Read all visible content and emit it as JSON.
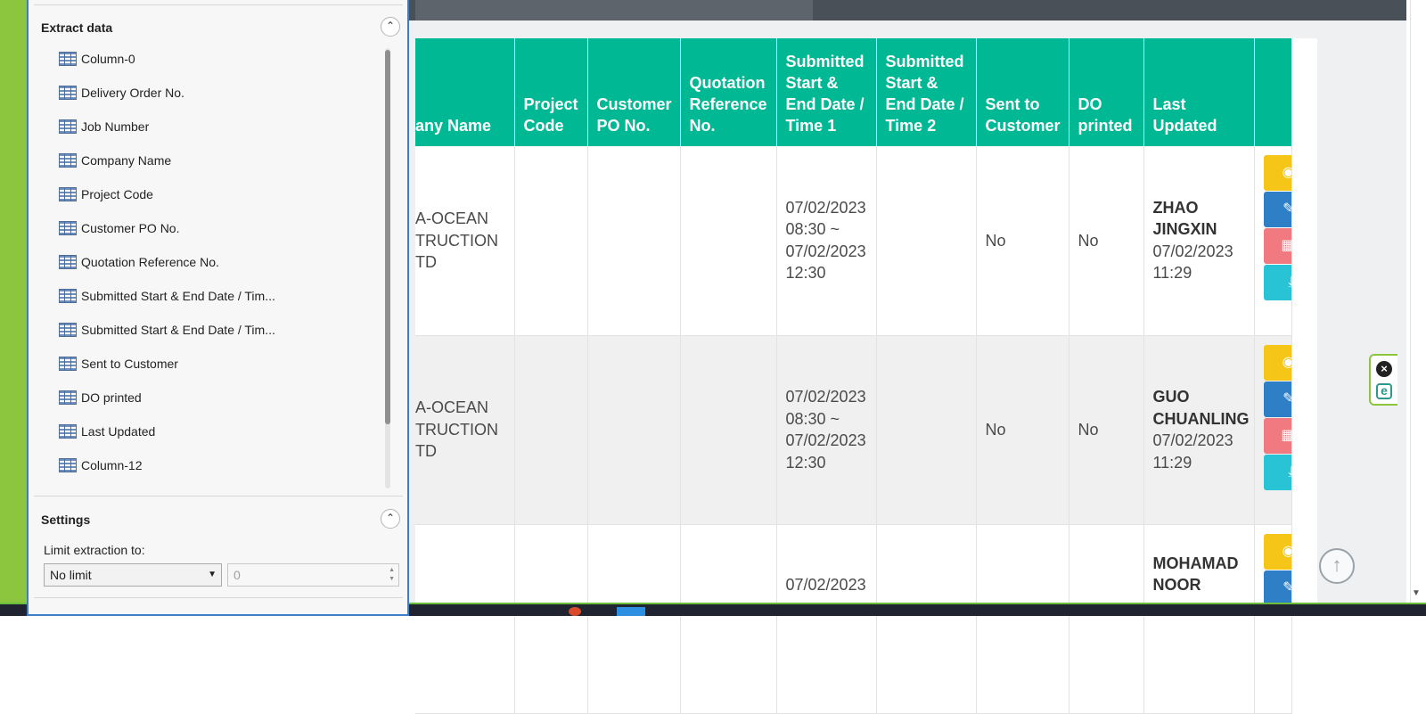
{
  "panel": {
    "extract_title": "Extract data",
    "columns": [
      "Column-0",
      "Delivery Order No.",
      "Job Number",
      "Company Name",
      "Project Code",
      "Customer PO No.",
      "Quotation Reference No.",
      "Submitted Start & End Date / Tim...",
      "Submitted Start & End Date / Tim...",
      "Sent to Customer",
      "DO printed",
      "Last Updated",
      "Column-12"
    ],
    "settings_title": "Settings",
    "limit_label": "Limit extraction to:",
    "limit_select_value": "No limit",
    "limit_number_value": "0"
  },
  "table": {
    "headers": {
      "company_name": "any Name",
      "project_code": "Project Code",
      "customer_po": "Customer PO No.",
      "quotation_ref": "Quotation Reference No.",
      "submitted_1": "Submitted Start & End Date / Time 1",
      "submitted_2": "Submitted Start & End Date / Time 2",
      "sent_to_customer": "Sent to Customer",
      "do_printed": "DO printed",
      "last_updated": "Last Updated"
    },
    "rows": [
      {
        "company": "A-OCEAN\nTRUCTION\nTD",
        "submitted_1": "07/02/2023 08:30 ~ 07/02/2023 12:30",
        "sent": "No",
        "printed": "No",
        "updated_by": "ZHAO JINGXIN",
        "updated_at": "07/02/2023 11:29"
      },
      {
        "company": "A-OCEAN\nTRUCTION\nTD",
        "submitted_1": "07/02/2023 08:30 ~ 07/02/2023 12:30",
        "sent": "No",
        "printed": "No",
        "updated_by": "GUO CHUANLING",
        "updated_at": "07/02/2023 11:29"
      },
      {
        "submitted_1": "07/02/2023",
        "updated_by": "MOHAMAD NOOR"
      }
    ]
  },
  "icons": {
    "collapse": "chevron-up-icon",
    "view": "eye-icon",
    "edit": "pencil-icon",
    "delete": "trash-icon",
    "download": "download-icon",
    "scroll_top": "arrow-up-icon",
    "ext_close": "close-icon",
    "ext_logo": "e-logo-icon"
  },
  "colors": {
    "table_header": "#00b894",
    "view_button": "#f5c518",
    "edit_button": "#2f7fc7",
    "delete_button": "#f07a80",
    "download_button": "#29c3d6",
    "panel_border": "#3d7dc9",
    "accent_green": "#8cc63f"
  }
}
